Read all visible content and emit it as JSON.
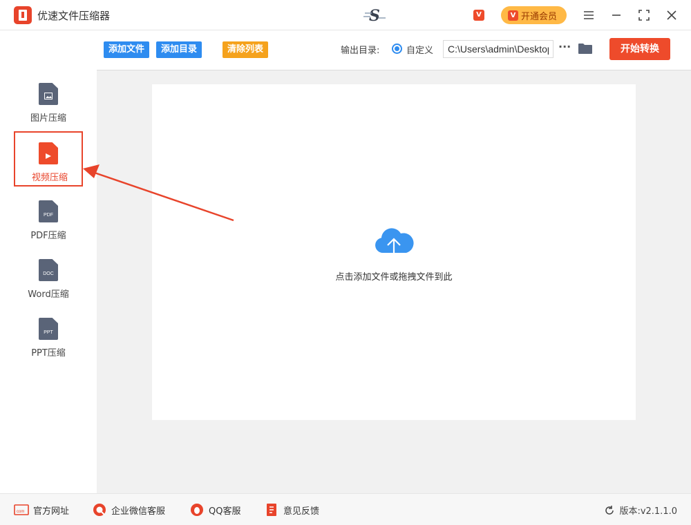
{
  "app": {
    "title": "优速文件压缩器"
  },
  "header": {
    "vip_small": "V",
    "vip_button": "开通会员",
    "vip_badge": "V"
  },
  "toolbar": {
    "add_file": "添加文件",
    "add_dir": "添加目录",
    "clear_list": "清除列表",
    "output_label": "输出目录:",
    "custom_label": "自定义",
    "output_path": "C:\\Users\\admin\\Desktop",
    "more": "···",
    "start": "开始转换"
  },
  "sidebar": {
    "items": [
      {
        "label": "图片压缩",
        "icon": "image-file-icon",
        "badge": ""
      },
      {
        "label": "视频压缩",
        "icon": "video-file-icon",
        "badge": "",
        "active": true
      },
      {
        "label": "PDF压缩",
        "icon": "pdf-file-icon",
        "badge": "PDF"
      },
      {
        "label": "Word压缩",
        "icon": "doc-file-icon",
        "badge": "DOC"
      },
      {
        "label": "PPT压缩",
        "icon": "ppt-file-icon",
        "badge": "PPT"
      }
    ]
  },
  "main": {
    "drop_text": "点击添加文件或拖拽文件到此"
  },
  "footer": {
    "website": "官方网址",
    "wechat": "企业微信客服",
    "qq": "QQ客服",
    "feedback": "意见反馈",
    "version": "版本:v2.1.1.0"
  },
  "colors": {
    "accent_red": "#ee4b2b",
    "blue": "#2e8cf0",
    "orange": "#f5a21c",
    "vip": "#ffb946"
  }
}
